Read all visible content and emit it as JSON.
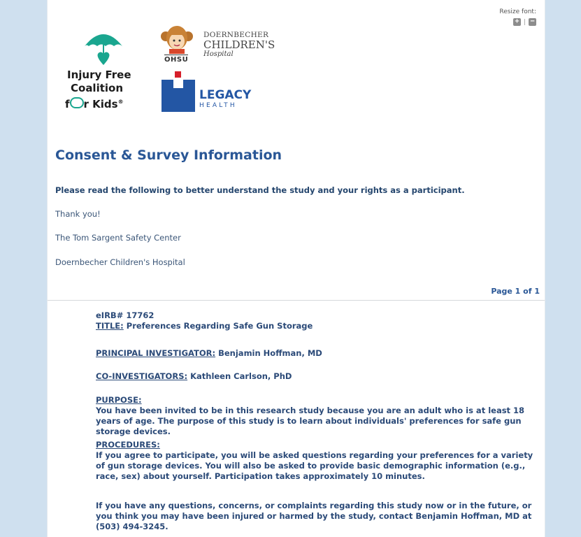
{
  "resize_font": {
    "label": "Resize font:",
    "separator": "|",
    "increase_glyph": "+",
    "decrease_glyph": "−"
  },
  "logos": {
    "injury_free": {
      "line1": "Injury Free",
      "line2": "Coalition",
      "line3_prefix": "f",
      "line3_suffix": "r Kids",
      "registered": "®"
    },
    "ohsu": {
      "mark": "OHSU",
      "line1": "DOERNBECHER",
      "line2": "CHILDREN'S",
      "line3": "Hospital"
    },
    "legacy": {
      "line1": "LEGACY",
      "line2": "HEALTH"
    }
  },
  "header": {
    "title": "Consent & Survey Information",
    "intro": "Please read the following to better understand the study and your rights as a participant.",
    "thanks": "Thank you!",
    "org1": "The Tom Sargent Safety Center",
    "org2": "Doernbecher Children's Hospital",
    "page_indicator": "Page 1 of 1"
  },
  "consent": {
    "eirb": "eIRB# 17762",
    "title_label": "TITLE:",
    "title_value": " Preferences Regarding Safe Gun Storage",
    "pi_label": "PRINCIPAL INVESTIGATOR:",
    "pi_value": " Benjamin Hoffman, MD",
    "coi_label": "CO-INVESTIGATORS:",
    "coi_value": " Kathleen Carlson, PhD",
    "purpose_label": "PURPOSE:",
    "purpose_text": "You have been invited to be in this research study because you are an adult who is at least 18 years of age. The purpose of this study is to learn about individuals' preferences for safe gun storage devices.",
    "procedures_label": "PROCEDURES:",
    "procedures_text": "If you agree to participate, you will be asked questions regarding your preferences for a variety of gun storage devices. You will also be asked to provide basic demographic information (e.g., race, sex) about yourself. Participation takes approximately 10 minutes.",
    "contact_text": "If you have any questions, concerns, or complaints regarding this study now or in the future, or you think you may have been injured or harmed by the study, contact Benjamin Hoffman, MD at (503) 494-3245."
  },
  "colors": {
    "page_bg": "#cfe0ef",
    "heading_blue": "#2a5796",
    "body_blue": "#2b4a78",
    "legacy_blue": "#2356a4",
    "umbrella_teal": "#1aa68f"
  }
}
